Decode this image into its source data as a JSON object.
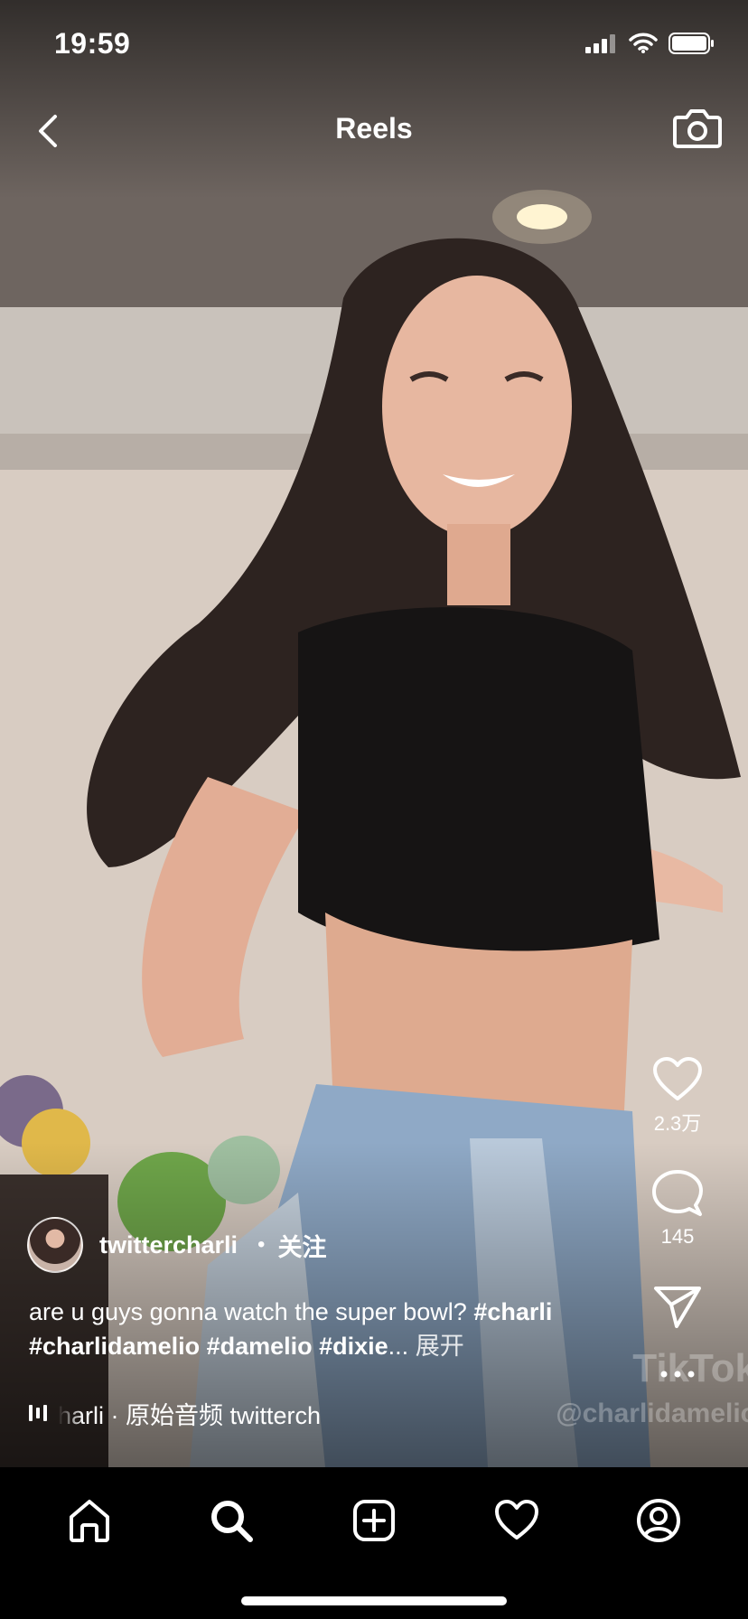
{
  "status_bar": {
    "time": "19:59"
  },
  "nav": {
    "title": "Reels"
  },
  "post": {
    "username": "twittercharli",
    "separator": "•",
    "follow_label": "关注",
    "caption_text": "are u guys gonna watch the super bowl? ",
    "caption_tags_line1": "#charli",
    "caption_tags_line2": "#charlidamelio #damelio #dixie",
    "caption_ellipsis": "...",
    "caption_more": " 展开",
    "audio_text": "harli · 原始音频   twitterch"
  },
  "actions": {
    "likes": "2.3万",
    "comments": "145"
  },
  "watermark": {
    "brand": "TikTok",
    "handle": "@charlidamelio"
  },
  "icons": {
    "back": "chevron-left-icon",
    "camera": "camera-icon",
    "like": "heart-icon",
    "comment": "comment-bubble-icon",
    "share": "paper-plane-icon",
    "more": "ellipsis-icon",
    "tabs": [
      "home-icon",
      "search-icon",
      "add-post-icon",
      "activity-heart-icon",
      "profile-icon"
    ]
  }
}
